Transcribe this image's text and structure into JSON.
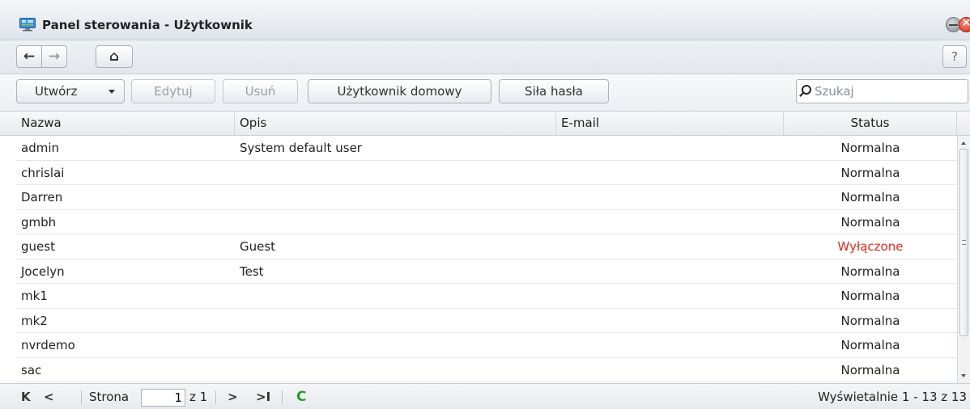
{
  "window": {
    "title": "Panel sterowania - Użytkownik",
    "close_glyph": "×"
  },
  "nav": {
    "back_glyph": "←",
    "forward_glyph": "→",
    "home_glyph": "⌂",
    "help_label": "?"
  },
  "toolbar": {
    "create_label": "Utwórz",
    "edit_label": "Edytuj",
    "delete_label": "Usuń",
    "home_user_label": "Użytkownik domowy",
    "password_strength_label": "Siła hasła",
    "search_placeholder": "Szukaj"
  },
  "table": {
    "columns": [
      "Nazwa",
      "Opis",
      "E-mail",
      "Status"
    ],
    "rows": [
      {
        "name": "admin",
        "description": "System default user",
        "email": "",
        "status": "Normalna"
      },
      {
        "name": "chrislai",
        "description": "",
        "email": "",
        "status": "Normalna"
      },
      {
        "name": "Darren",
        "description": "",
        "email": "",
        "status": "Normalna"
      },
      {
        "name": "gmbh",
        "description": "",
        "email": "",
        "status": "Normalna"
      },
      {
        "name": "guest",
        "description": "Guest",
        "email": "",
        "status": "Wyłączone"
      },
      {
        "name": "Jocelyn",
        "description": "Test",
        "email": "",
        "status": "Normalna"
      },
      {
        "name": "mk1",
        "description": "",
        "email": "",
        "status": "Normalna"
      },
      {
        "name": "mk2",
        "description": "",
        "email": "",
        "status": "Normalna"
      },
      {
        "name": "nvrdemo",
        "description": "",
        "email": "",
        "status": "Normalna"
      },
      {
        "name": "sac",
        "description": "",
        "email": "",
        "status": "Normalna"
      }
    ],
    "disabled_status_color": "#e8281c"
  },
  "pager": {
    "first_glyph": "K",
    "prev_glyph": "<",
    "page_label": "Strona",
    "page_value": "1",
    "of_label": "z 1",
    "next_glyph": ">",
    "last_glyph": ">I",
    "refresh_glyph": "C",
    "display_summary": "Wyświetalnie 1 - 13 z 13"
  }
}
